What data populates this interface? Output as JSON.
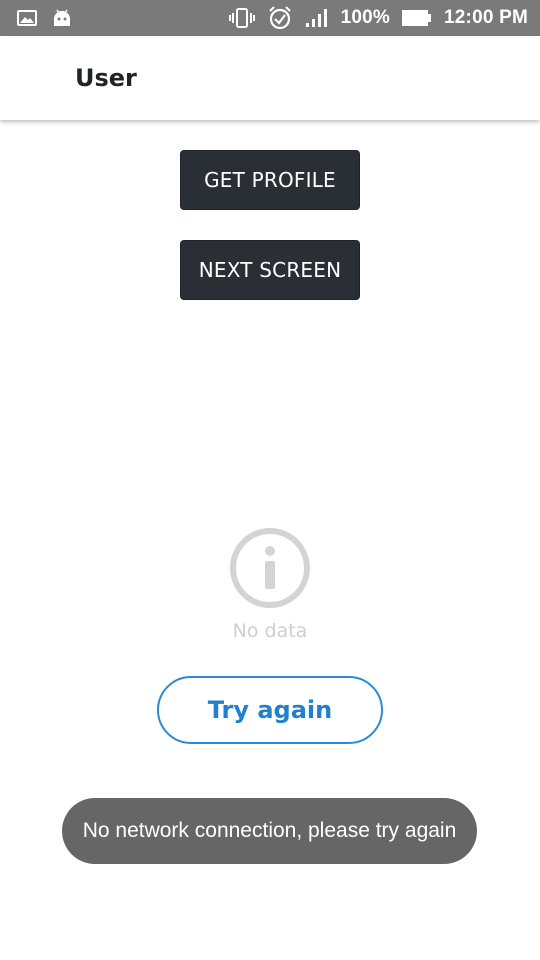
{
  "status_bar": {
    "battery_percent": "100%",
    "time": "12:00 PM",
    "icons": [
      "image-icon",
      "android-icon",
      "vibrate-icon",
      "alarm-icon",
      "signal-icon",
      "battery-icon"
    ]
  },
  "app_bar": {
    "title": "User"
  },
  "actions": {
    "get_profile": "GET PROFILE",
    "next_screen": "NEXT SCREEN"
  },
  "empty_state": {
    "icon": "info-icon",
    "message": "No data",
    "retry_label": "Try again"
  },
  "toast": {
    "message": "No network connection, please try again"
  },
  "colors": {
    "status_bar": "#7a7a7a",
    "dark_button": "#2a2f36",
    "accent": "#1f80d2",
    "toast": "#666666",
    "muted": "#cfcfcf"
  }
}
